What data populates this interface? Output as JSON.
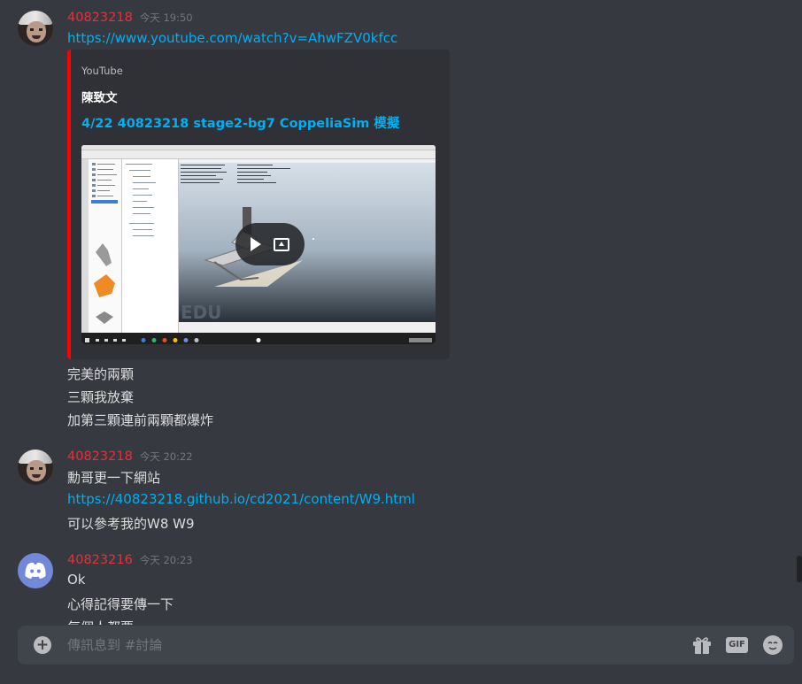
{
  "messages": [
    {
      "username": "40823218",
      "timestamp": "今天 19:50",
      "link": "https://www.youtube.com/watch?v=AhwFZV0kfcc",
      "embed": {
        "provider": "YouTube",
        "author": "陳致文",
        "title": "4/22 40823218 stage2-bg7 CoppeliaSim 模擬",
        "thumb_watermark": "EDU"
      },
      "lines": [
        "完美的兩顆",
        "三顆我放棄",
        "加第三顆連前兩顆都爆炸"
      ]
    },
    {
      "username": "40823218",
      "timestamp": "今天 20:22",
      "lines": [
        "勳哥更一下網站"
      ],
      "link": "https://40823218.github.io/cd2021/content/W9.html",
      "after": "可以參考我的W8 W9"
    },
    {
      "username": "40823216",
      "timestamp": "今天 20:23",
      "lines": [
        "Ok",
        "心得記得要傳一下",
        "每個人都要"
      ]
    }
  ],
  "composer": {
    "placeholder": "傳訊息到 #討論",
    "gif_label": "GIF"
  },
  "colors": {
    "background": "#36393f",
    "username": "#e0333e",
    "link": "#00aff4",
    "embed_border": "#ff0000"
  }
}
